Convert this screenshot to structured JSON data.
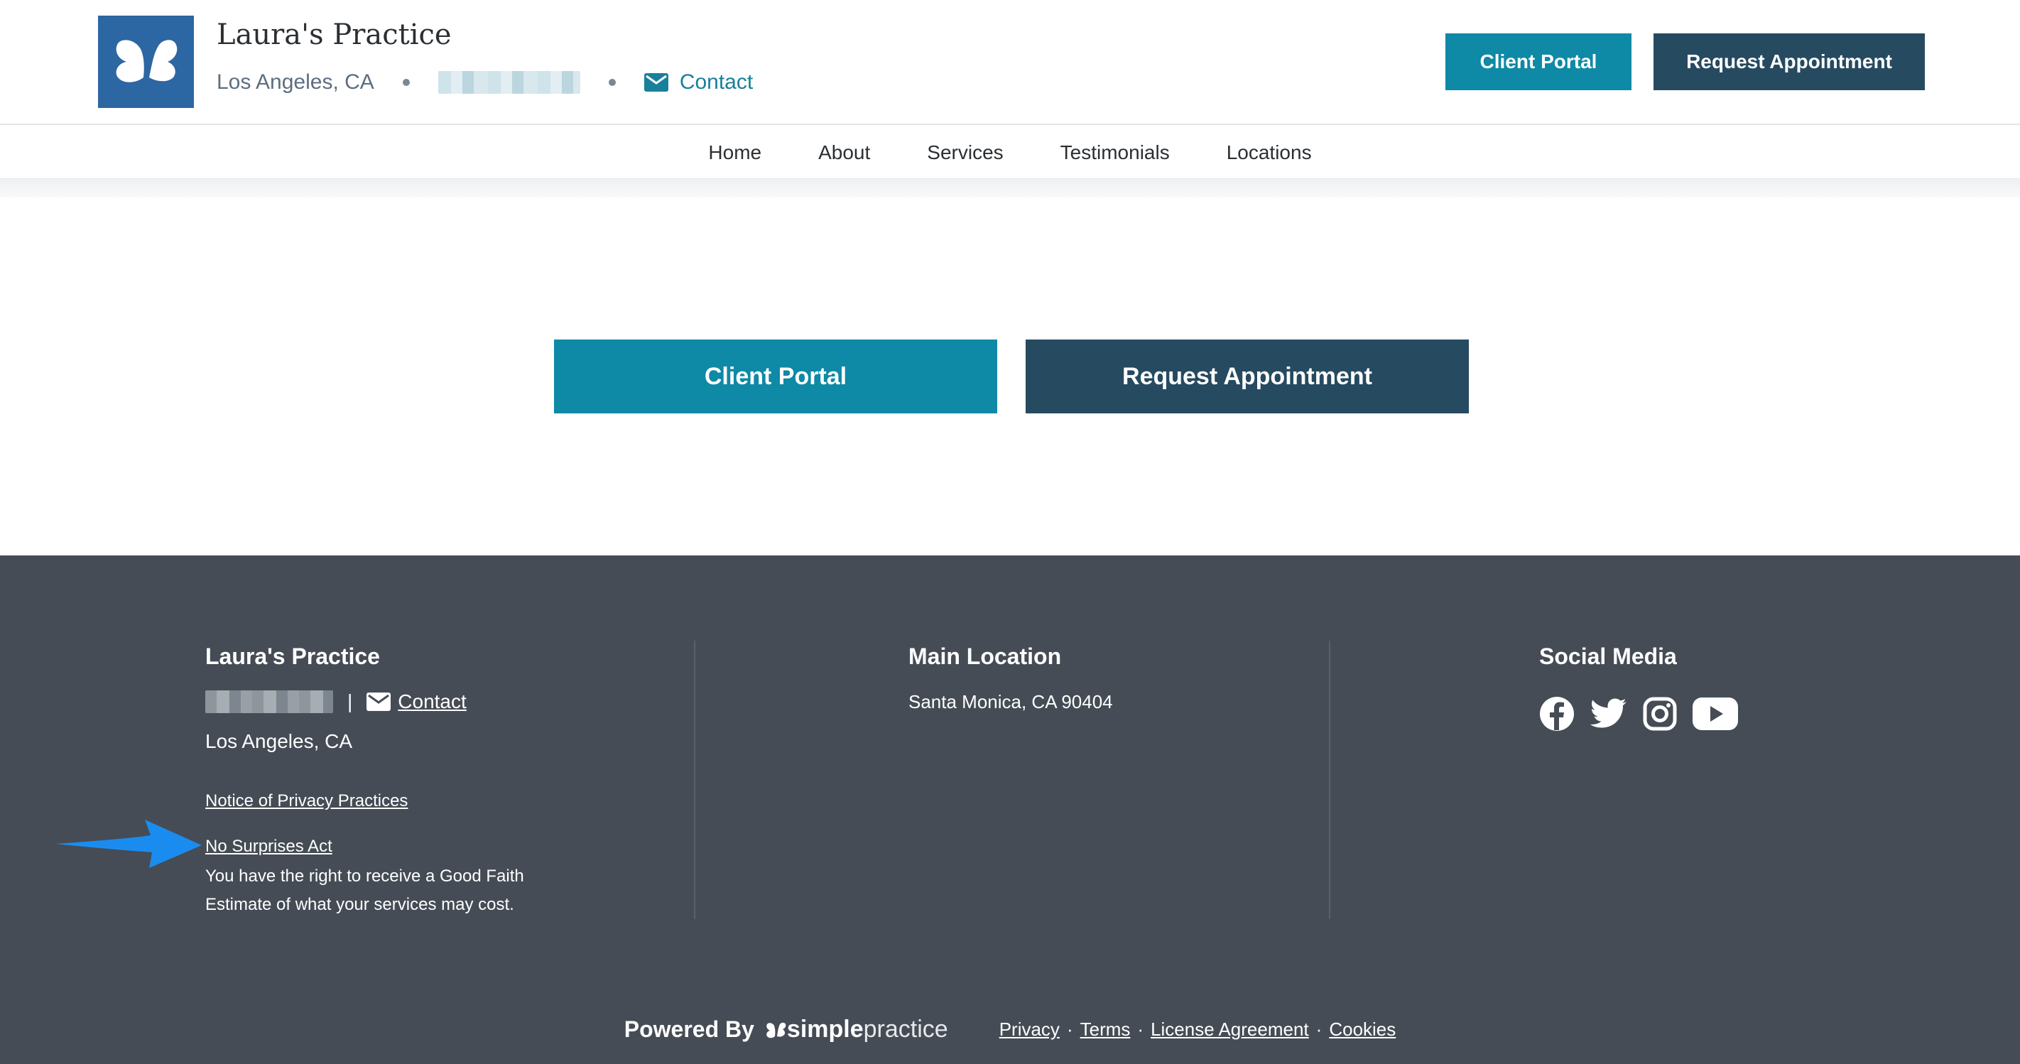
{
  "header": {
    "practice_name": "Laura's Practice",
    "location": "Los Angeles, CA",
    "contact_label": "Contact",
    "client_portal_label": "Client Portal",
    "request_appointment_label": "Request Appointment"
  },
  "nav": {
    "items": [
      "Home",
      "About",
      "Services",
      "Testimonials",
      "Locations"
    ]
  },
  "main": {
    "client_portal_label": "Client Portal",
    "request_appointment_label": "Request Appointment"
  },
  "footer": {
    "practice": {
      "title": "Laura's Practice",
      "separator": "|",
      "contact_label": "Contact",
      "location": "Los Angeles, CA",
      "privacy_notice_label": "Notice of Privacy Practices",
      "no_surprises_label": "No Surprises Act",
      "good_faith_line1": "You have the right to receive a Good Faith",
      "good_faith_line2": "Estimate of what your services may cost."
    },
    "main_location": {
      "title": "Main Location",
      "address": "Santa Monica, CA 90404"
    },
    "social": {
      "title": "Social Media",
      "icons": [
        "facebook-icon",
        "twitter-icon",
        "instagram-icon",
        "youtube-icon"
      ]
    },
    "bottom": {
      "powered_by": "Powered By",
      "brand_part1": "simple",
      "brand_part2": "practice",
      "links": [
        "Privacy",
        "Terms",
        "License Agreement",
        "Cookies"
      ],
      "link_separator": "·"
    }
  },
  "colors": {
    "teal": "#0e89a6",
    "navy": "#264a60",
    "logo_blue": "#2c66a3",
    "footer_bg": "#454c55",
    "arrow_blue": "#1a8cf0"
  }
}
